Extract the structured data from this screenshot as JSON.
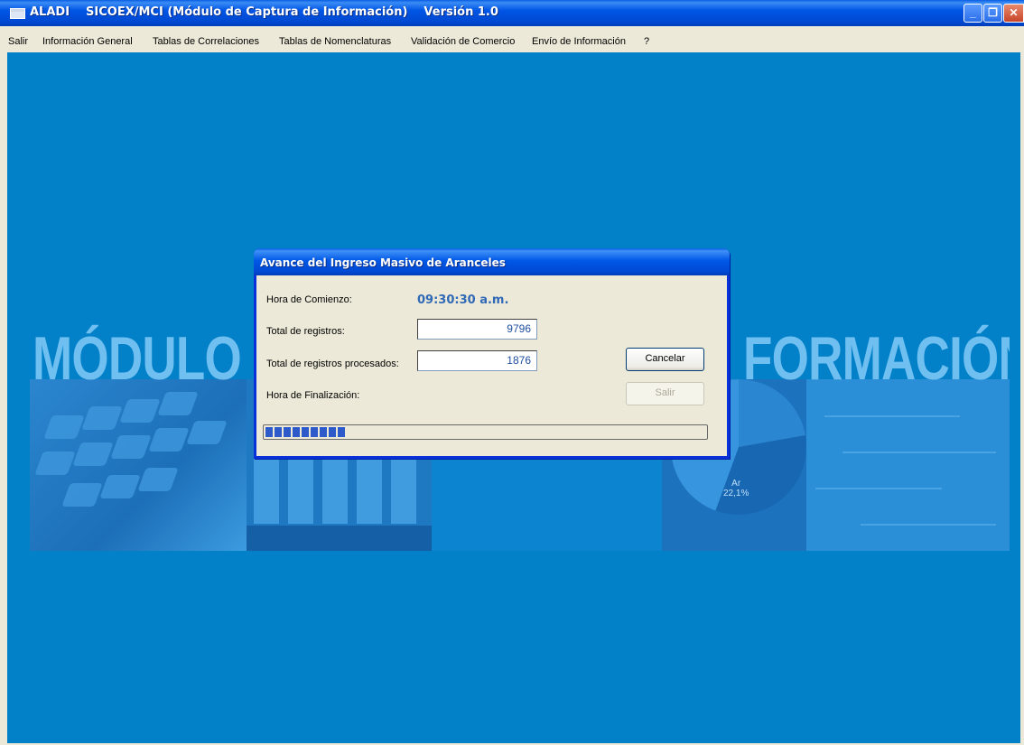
{
  "window": {
    "app_name": "ALADI",
    "module_title": "SICOEX/MCI (Módulo de Captura de Información)",
    "version": "Versión 1.0",
    "controls": {
      "minimize": "minimize-icon",
      "restore": "restore-icon",
      "close": "close-icon"
    }
  },
  "menu": {
    "items": [
      "Salir",
      "Información General",
      "Tablas de Correlaciones",
      "Tablas de Nomenclaturas",
      "Validación de Comercio",
      "Envío de Información",
      "?"
    ]
  },
  "background": {
    "banner_left": "MÓDULO",
    "banner_right": "FORMACIÓN",
    "pie_label": "Ar\n22,1%"
  },
  "dialog": {
    "title": "Avance del Ingreso Masivo de Aranceles",
    "start_label": "Hora de Comienzo:",
    "start_value": "09:30:30 a.m.",
    "total_label": "Total de registros:",
    "total_value": "9796",
    "processed_label": "Total de registros procesados:",
    "processed_value": "1876",
    "end_label": "Hora de Finalización:",
    "cancel_label": "Cancelar",
    "exit_label": "Salir",
    "progress_fraction": 0.1915
  },
  "colors": {
    "titlebar": "#0055e5",
    "desktop": "#0280c8",
    "dialog_bg": "#ece9d8",
    "progress": "#2f5ac9",
    "time_text": "#3069b6"
  }
}
